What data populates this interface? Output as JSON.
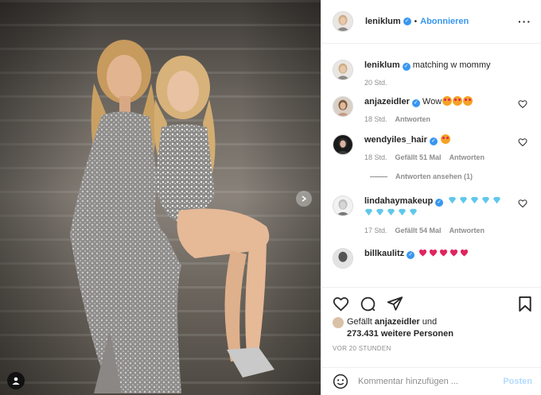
{
  "post": {
    "username": "leniklum",
    "follow_label": "Abonnieren",
    "separator": "•",
    "more_label": "···",
    "caption": "matching w mommy",
    "caption_time": "20 Std."
  },
  "comments": [
    {
      "username": "anjazeidler",
      "text": "Wow",
      "time": "18 Std.",
      "likes": "",
      "reply": "Antworten"
    },
    {
      "username": "wendyiles_hair",
      "text": "",
      "time": "18 Std.",
      "likes": "Gefällt 51 Mal",
      "reply": "Antworten",
      "view_replies": "Antworten ansehen (1)"
    },
    {
      "username": "lindahaymakeup",
      "text": "",
      "time": "17 Std.",
      "likes": "Gefällt 54 Mal",
      "reply": "Antworten"
    },
    {
      "username": "billkaulitz",
      "text": "",
      "time": "",
      "likes": "",
      "reply": ""
    }
  ],
  "likes": {
    "prefix": "Gefällt",
    "liker": "anjazeidler",
    "conj": "und",
    "count": "273.431 weitere Personen"
  },
  "timestamp": "VOR 20 STUNDEN",
  "comment_box": {
    "placeholder": "Kommentar hinzufügen ...",
    "post_label": "Posten"
  },
  "colors": {
    "accent": "#3897f0",
    "muted": "#8e8e8e",
    "post_disabled": "#b3dbff"
  }
}
